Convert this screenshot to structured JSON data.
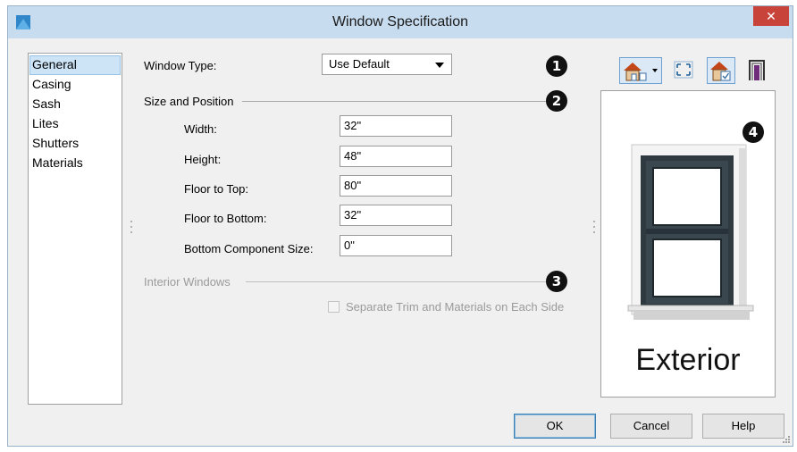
{
  "window": {
    "title": "Window Specification",
    "close_glyph": "✕"
  },
  "sidebar": {
    "items": [
      {
        "label": "General",
        "selected": true
      },
      {
        "label": "Casing"
      },
      {
        "label": "Sash"
      },
      {
        "label": "Lites"
      },
      {
        "label": "Shutters"
      },
      {
        "label": "Materials"
      }
    ]
  },
  "general": {
    "window_type_label": "Window Type:",
    "window_type_value": "Use Default",
    "size_position_heading": "Size and Position",
    "fields": {
      "width": {
        "label": "Width:",
        "value": "32\""
      },
      "height": {
        "label": "Height:",
        "value": "48\""
      },
      "floor_to_top": {
        "label": "Floor to Top:",
        "value": "80\""
      },
      "floor_to_bottom": {
        "label": "Floor to Bottom:",
        "value": "32\""
      },
      "bottom_component_size": {
        "label": "Bottom Component Size:",
        "value": "0\""
      }
    },
    "interior_windows_heading": "Interior Windows",
    "separate_trim_label": "Separate Trim and Materials on Each Side",
    "separate_trim_checked": false,
    "separate_trim_enabled": false
  },
  "callouts": [
    "1",
    "2",
    "3",
    "4"
  ],
  "preview": {
    "caption": "Exterior",
    "toolbar_icons": [
      "house-view-dropdown-icon",
      "fit-to-window-icon",
      "house-window-icon",
      "window-frame-icon"
    ]
  },
  "buttons": {
    "ok": "OK",
    "cancel": "Cancel",
    "help": "Help"
  },
  "colors": {
    "titlebar": "#c8dcef",
    "close": "#c8443a",
    "selection": "#cde4f7",
    "window_frame": "#2f3a40"
  }
}
